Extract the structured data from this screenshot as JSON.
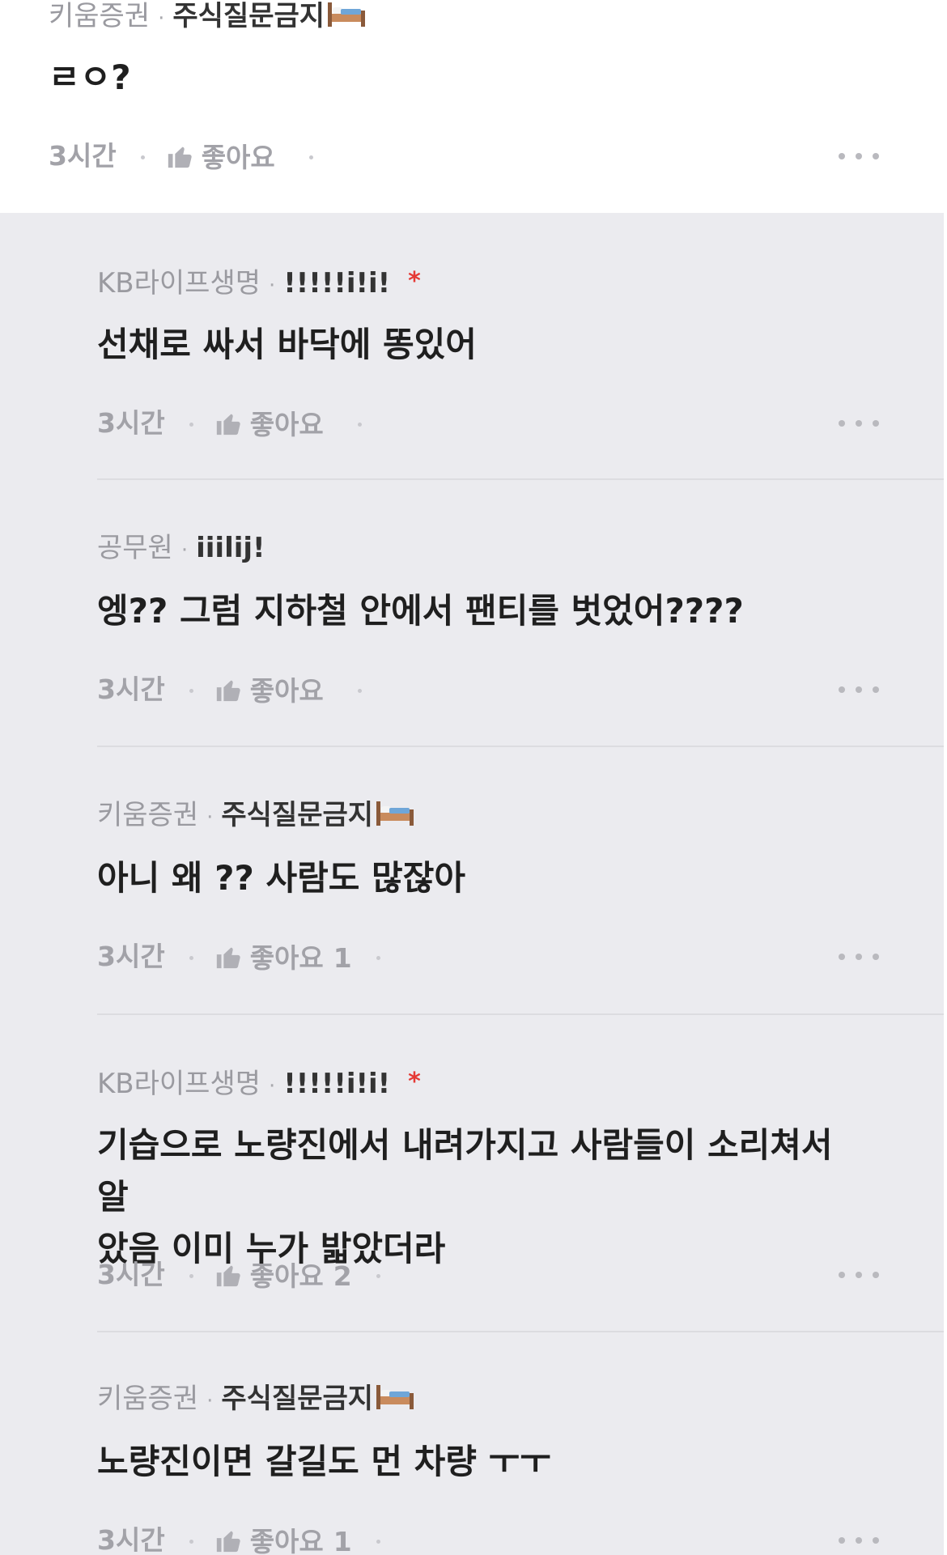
{
  "comments": [
    {
      "company": "키움증권",
      "nickname": "주식질문금지",
      "text": "ㄹㅇ?",
      "time": "3시간",
      "like_label": "좋아요",
      "like_count": "",
      "has_bed": true,
      "has_asterisk": false
    },
    {
      "company": "KB라이프생명",
      "nickname": "!!!!!i!i!",
      "text": "선채로 싸서 바닥에 똥있어",
      "time": "3시간",
      "like_label": "좋아요",
      "like_count": "",
      "has_bed": false,
      "has_asterisk": true
    },
    {
      "company": "공무원",
      "nickname": "iiilij!",
      "text": "엥?? 그럼 지하철 안에서 팬티를 벗었어????",
      "time": "3시간",
      "like_label": "좋아요",
      "like_count": "",
      "has_bed": false,
      "has_asterisk": false
    },
    {
      "company": "키움증권",
      "nickname": "주식질문금지",
      "text": "아니 왜 ?? 사람도 많잖아",
      "time": "3시간",
      "like_label": "좋아요",
      "like_count": "1",
      "has_bed": true,
      "has_asterisk": false
    },
    {
      "company": "KB라이프생명",
      "nickname": "!!!!!i!i!",
      "text": "기습으로 노량진에서 내려가지고 사람들이 소리쳐서 알\n았음 이미 누가 밟았더라",
      "time": "3시간",
      "like_label": "좋아요",
      "like_count": "2",
      "has_bed": false,
      "has_asterisk": true
    },
    {
      "company": "키움증권",
      "nickname": "주식질문금지",
      "text": "노량진이면 갈길도 먼 차량 ㅜㅜ",
      "time": "3시간",
      "like_label": "좋아요",
      "like_count": "1",
      "has_bed": true,
      "has_asterisk": false
    }
  ],
  "separator": "·",
  "asterisk": "*",
  "icons": {
    "like": "thumbs-up-icon",
    "more": "more-dots-icon",
    "bed": "bed-emoji-icon"
  },
  "colors": {
    "reply_background": "#ebebef",
    "asterisk": "#e53935"
  }
}
